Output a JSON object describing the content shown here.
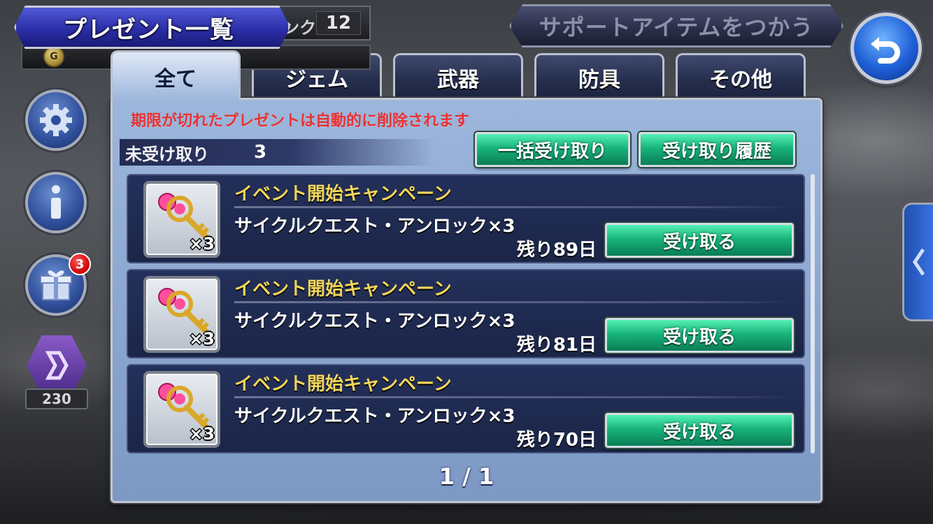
{
  "header": {
    "title": "プレゼント一覧",
    "rank_label": "ンク",
    "rank_value": "12",
    "support_button": "サポートアイテムをつかう"
  },
  "tabs": [
    {
      "label": "全て",
      "active": true
    },
    {
      "label": "ジェム",
      "active": false
    },
    {
      "label": "武器",
      "active": false
    },
    {
      "label": "防具",
      "active": false
    },
    {
      "label": "その他",
      "active": false
    }
  ],
  "panel": {
    "notice": "期限が切れたプレゼントは自動的に削除されます",
    "unclaimed_label": "未受け取り",
    "unclaimed_count": "3",
    "claim_all_button": "一括受け取り",
    "history_button": "受け取り履歴",
    "pager": "1 / 1"
  },
  "items": [
    {
      "title": "イベント開始キャンペーン",
      "name": "サイクルクエスト・アンロック×3",
      "quantity": "×3",
      "remaining": "残り89日",
      "button": "受け取る",
      "icon": "key-icon"
    },
    {
      "title": "イベント開始キャンペーン",
      "name": "サイクルクエスト・アンロック×3",
      "quantity": "×3",
      "remaining": "残り81日",
      "button": "受け取る",
      "icon": "key-icon"
    },
    {
      "title": "イベント開始キャンペーン",
      "name": "サイクルクエスト・アンロック×3",
      "quantity": "×3",
      "remaining": "残り70日",
      "button": "受け取る",
      "icon": "key-icon"
    }
  ],
  "side_menu": {
    "gift_badge": "3",
    "stamina_count": "230",
    "icons": [
      "gear-icon",
      "info-icon",
      "gift-icon",
      "dimension-icon"
    ]
  },
  "colors": {
    "accent_green": "#18b47c",
    "notice_red": "#e83232",
    "item_title_gold": "#f2d65a",
    "panel_blue": "#9cb6dc"
  }
}
